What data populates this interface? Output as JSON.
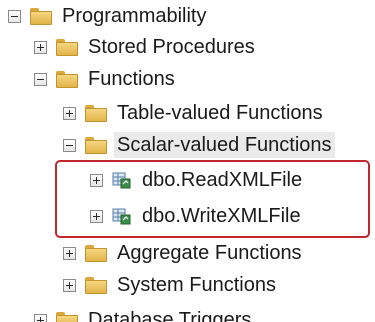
{
  "tree": {
    "programmability": {
      "label": "Programmability",
      "state": "expanded"
    },
    "stored_procedures": {
      "label": "Stored Procedures",
      "state": "collapsed"
    },
    "functions": {
      "label": "Functions",
      "state": "expanded"
    },
    "table_valued": {
      "label": "Table-valued Functions",
      "state": "collapsed"
    },
    "scalar_valued": {
      "label": "Scalar-valued Functions",
      "state": "expanded"
    },
    "read_xml": {
      "label": "dbo.ReadXMLFile",
      "state": "collapsed",
      "icon": "scalar-function-icon"
    },
    "write_xml": {
      "label": "dbo.WriteXMLFile",
      "state": "collapsed",
      "icon": "scalar-function-icon"
    },
    "aggregate": {
      "label": "Aggregate Functions",
      "state": "collapsed"
    },
    "system": {
      "label": "System Functions",
      "state": "collapsed"
    },
    "database_triggers": {
      "label": "Database Triggers",
      "state": "collapsed"
    }
  },
  "colors": {
    "highlight_border": "#c0282d",
    "folder": "#e2b24a",
    "selection": "#eaeaea"
  }
}
